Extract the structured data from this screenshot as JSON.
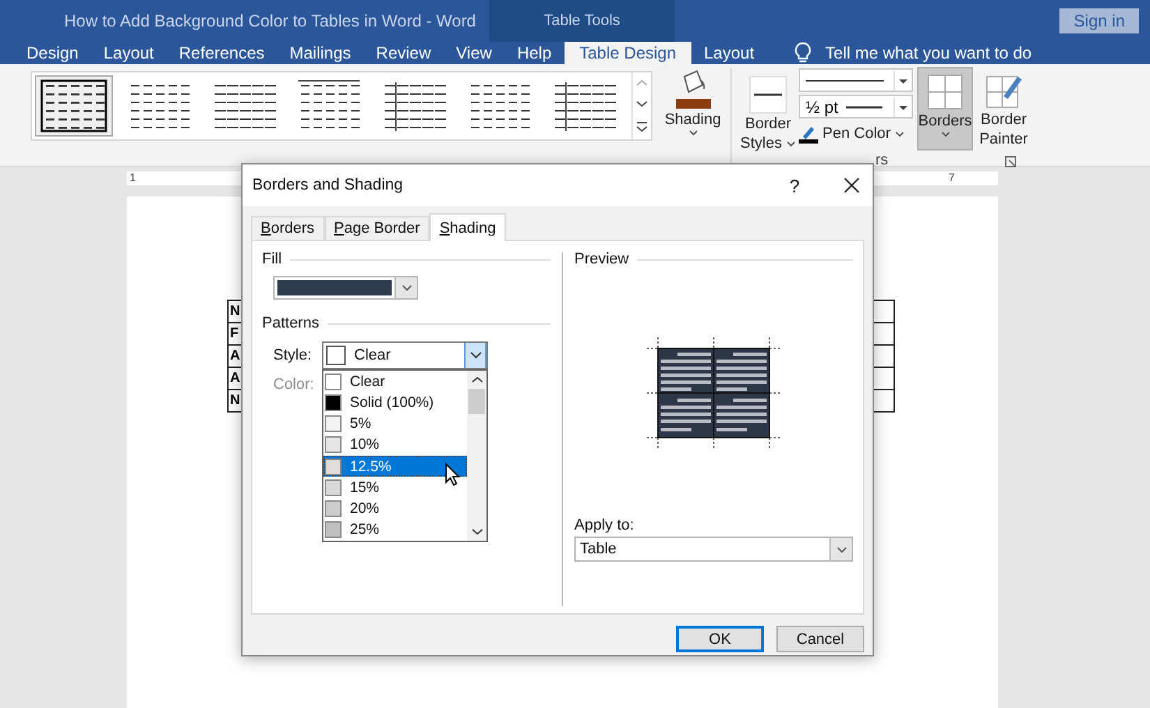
{
  "window": {
    "title": "How to Add Background Color to Tables in Word  -  Word",
    "context_group": "Table Tools",
    "sign_in": "Sign in"
  },
  "tabs": [
    {
      "label": "Design",
      "selected": false
    },
    {
      "label": "Layout",
      "selected": false
    },
    {
      "label": "References",
      "selected": false
    },
    {
      "label": "Mailings",
      "selected": false
    },
    {
      "label": "Review",
      "selected": false
    },
    {
      "label": "View",
      "selected": false
    },
    {
      "label": "Help",
      "selected": false
    },
    {
      "label": "Table Design",
      "selected": true
    },
    {
      "label": "Layout",
      "selected": false
    }
  ],
  "tell_me": "Tell me what you want to do",
  "ribbon": {
    "table_styles": [
      {
        "selected": true
      },
      {
        "selected": false
      },
      {
        "selected": false
      },
      {
        "selected": false
      },
      {
        "selected": false
      },
      {
        "selected": false
      },
      {
        "selected": false
      }
    ],
    "shading": "Shading",
    "border_styles": "Border Styles",
    "line_weight": "½ pt",
    "pen_color": "Pen Color",
    "borders": {
      "label": "Borders",
      "selected": true
    },
    "border_painter": "Border Painter",
    "group_label": "rs"
  },
  "ruler": [
    "1",
    "7"
  ],
  "document_table": {
    "rows": [
      {
        "column_1": "N"
      },
      {
        "column_1": "F"
      },
      {
        "column_1": "A"
      },
      {
        "column_1": "A"
      },
      {
        "column_1": "N"
      }
    ]
  },
  "dialog": {
    "title": "Borders and Shading",
    "help": "?",
    "tabs": [
      {
        "label": "Borders",
        "selected": false
      },
      {
        "label": "Page Border",
        "selected": false
      },
      {
        "label": "Shading",
        "selected": true
      }
    ],
    "fill_label": "Fill",
    "patterns_label": "Patterns",
    "style_label": "Style:",
    "style_value": "Clear",
    "color_label": "Color:",
    "color_disabled": true,
    "style_options": [
      {
        "label": "Clear",
        "color": "#ffffff",
        "selected": false
      },
      {
        "label": "Solid (100%)",
        "color": "#000000",
        "selected": false
      },
      {
        "label": "5%",
        "color": "#f2f2f2",
        "selected": false
      },
      {
        "label": "10%",
        "color": "#e6e6e6",
        "selected": false
      },
      {
        "label": "12.5%",
        "color": "#e0dcd8",
        "selected": true
      },
      {
        "label": "15%",
        "color": "#d9d9d9",
        "selected": false
      },
      {
        "label": "20%",
        "color": "#cccccc",
        "selected": false
      },
      {
        "label": "25%",
        "color": "#bfbfbf",
        "selected": false
      }
    ],
    "preview_label": "Preview",
    "apply_to_label": "Apply to:",
    "apply_to_value": "Table",
    "buttons": [
      {
        "label": "OK",
        "default": true
      },
      {
        "label": "Cancel",
        "default": false
      }
    ]
  }
}
